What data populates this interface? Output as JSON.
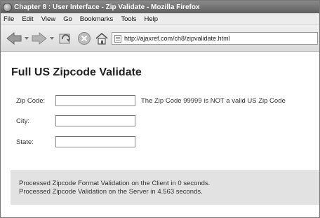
{
  "window": {
    "title": "Chapter 8 : User Interface - Zip Validate - Mozilla Firefox"
  },
  "menubar": {
    "items": [
      "File",
      "Edit",
      "View",
      "Go",
      "Bookmarks",
      "Tools",
      "Help"
    ]
  },
  "toolbar": {
    "icons": [
      "back-icon",
      "forward-icon",
      "reload-icon",
      "stop-icon",
      "home-icon"
    ],
    "url": "http://ajaxref.com/ch8/zipvalidate.html"
  },
  "page": {
    "title": "Full US Zipcode Validate",
    "form": {
      "zip_label": "Zip Code:",
      "zip_value": "",
      "zip_message": "The Zip Code 99999 is NOT a valid US Zip Code",
      "city_label": "City:",
      "city_value": "",
      "state_label": "State:",
      "state_value": ""
    },
    "status": {
      "line1": "Processed Zipcode Format Validation on the Client in 0 seconds.",
      "line2": "Processed Zipcode Validation on the Server in 4.563 seconds."
    }
  }
}
